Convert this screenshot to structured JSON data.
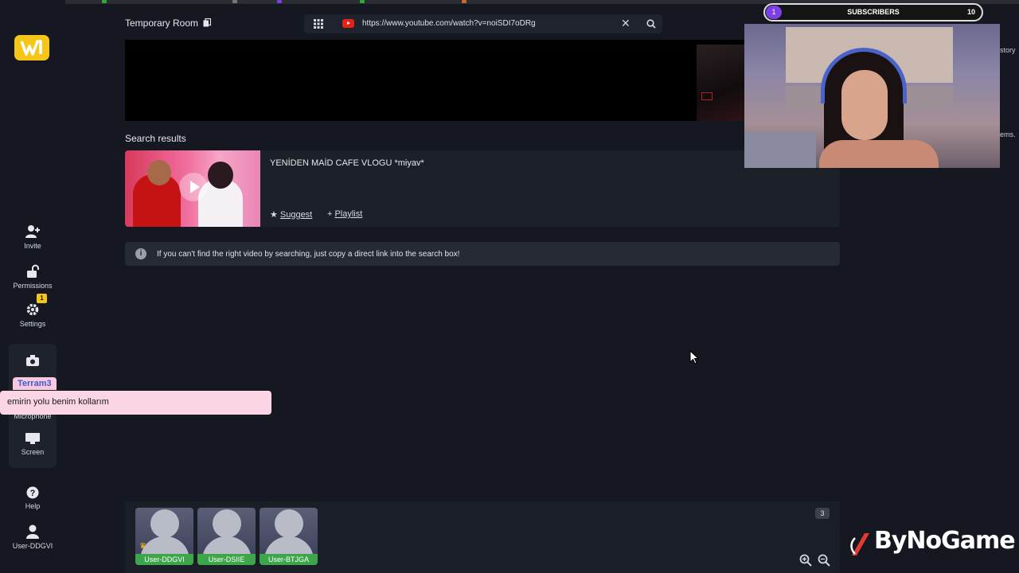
{
  "sidebar": {
    "items": [
      {
        "label": "Invite",
        "icon": "add-user-icon"
      },
      {
        "label": "Permissions",
        "icon": "lock-icon"
      },
      {
        "label": "Settings",
        "icon": "gear-icon",
        "badge": "1"
      },
      {
        "label": "Microphone",
        "icon": "microphone-icon"
      },
      {
        "label": "Screen",
        "icon": "monitor-icon"
      },
      {
        "label": "Help",
        "icon": "help-icon"
      },
      {
        "label": "User-DDGVI",
        "icon": "user-icon"
      }
    ]
  },
  "header": {
    "room_title": "Temporary Room",
    "url": "https://www.youtube.com/watch?v=noiSDI7oDRg",
    "clear_label": "✕"
  },
  "results": {
    "heading": "Search results",
    "items": [
      {
        "title": "YENİDEN MAİD CAFE VLOGU *miyav*",
        "suggest_label": "Suggest",
        "playlist_label": "Playlist"
      }
    ]
  },
  "info": {
    "text": "If you can't find the right video by searching, just copy a direct link into the search box!"
  },
  "chat": {
    "user": "Terram3",
    "message": "emirin yolu benim kollarım"
  },
  "overlay": {
    "subscribers_label": "SUBSCRIBERS",
    "subscribers_current": "1",
    "subscribers_goal": "10",
    "side_fragments": [
      "story",
      "ems."
    ]
  },
  "users": {
    "count": "3",
    "tiles": [
      {
        "name": "User-DDGVI"
      },
      {
        "name": "User-DSIIE"
      },
      {
        "name": "User-BTJGA"
      }
    ]
  },
  "watermark": {
    "text": "ByNoGame"
  },
  "colors": {
    "accent": "#f5c518",
    "user_tag": "#3da64a",
    "chat_bg": "#fbd5e3",
    "youtube_red": "#e62117"
  }
}
